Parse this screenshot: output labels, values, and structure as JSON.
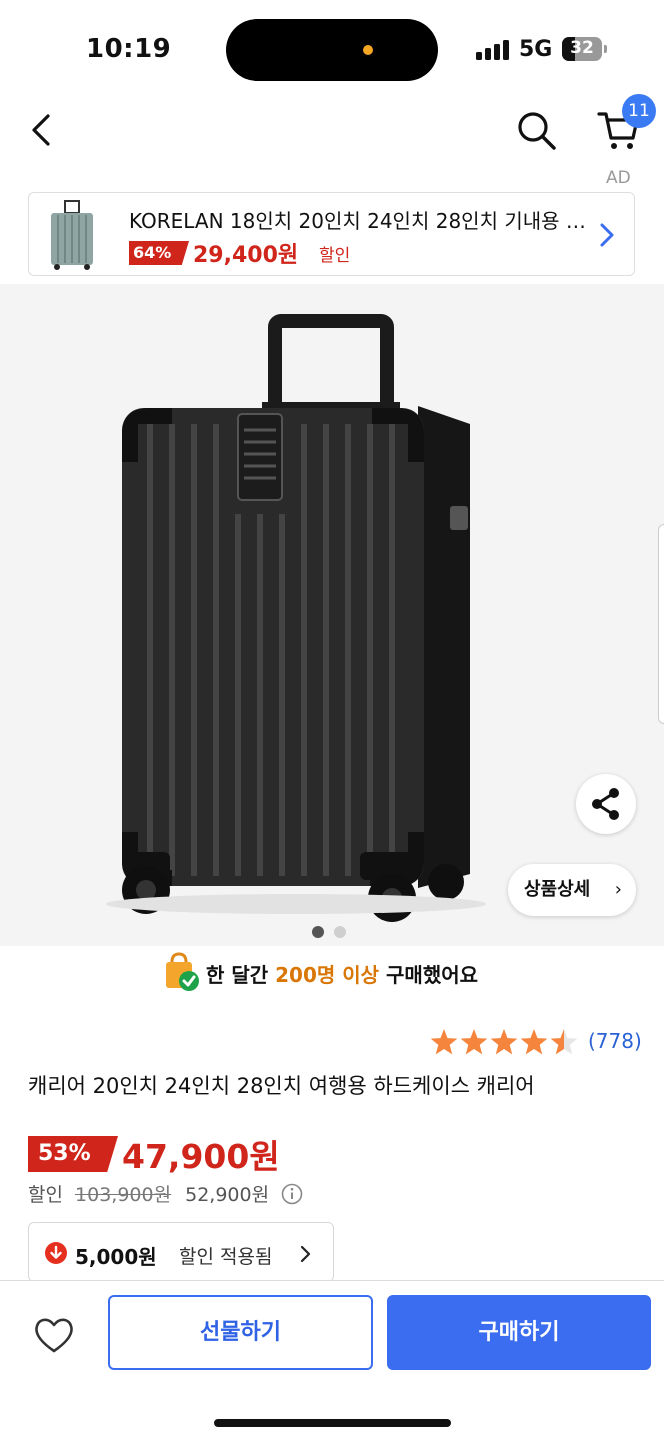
{
  "status_bar": {
    "time": "10:19",
    "network": "5G",
    "battery": "32",
    "battery_level": 0.32,
    "signal_icon": "signal-bars-icon"
  },
  "header": {
    "back_icon": "chevron-left-icon",
    "search_icon": "search-icon",
    "cart_icon": "cart-icon",
    "cart_count": "11",
    "ad_label": "AD"
  },
  "ad_banner": {
    "title": "KORELAN 18인치 20인치 24인치 28인치 기내용 캐리어",
    "discount": "64%",
    "price": "29,400원",
    "sale_label": "할인",
    "chevron_icon": "chevron-right-icon"
  },
  "gallery": {
    "image_icon": "suitcase-image",
    "share_icon": "share-icon",
    "detail_label": "상품상세",
    "detail_chevron": "›",
    "page_count": 2,
    "current_page": 1
  },
  "social_proof": {
    "icon": "shopping-bag-check-icon",
    "prefix": "한 달간 ",
    "highlight": "200명 이상",
    "suffix": " 구매했어요"
  },
  "rating": {
    "value": 4.5,
    "max": 5,
    "review_count": "(778)",
    "star_color": "#f5843c"
  },
  "product": {
    "title": "캐리어 20인치 24인치 28인치 여행용 하드케이스 캐리어",
    "discount": "53%",
    "price": "47,900원",
    "sale_label": "할인",
    "original_price": "103,900원",
    "sale_price": "52,900원",
    "info_icon": "info-icon"
  },
  "coupon": {
    "icon": "arrow-down-circle-icon",
    "amount": "5,000원",
    "label": "할인 적용됨",
    "chevron_icon": "chevron-right-icon"
  },
  "bottom_bar": {
    "wish_icon": "heart-icon",
    "gift_label": "선물하기",
    "buy_label": "구매하기"
  },
  "colors": {
    "accent_blue": "#3a6df0",
    "sale_red": "#d0251a",
    "highlight_orange": "#d97706"
  }
}
